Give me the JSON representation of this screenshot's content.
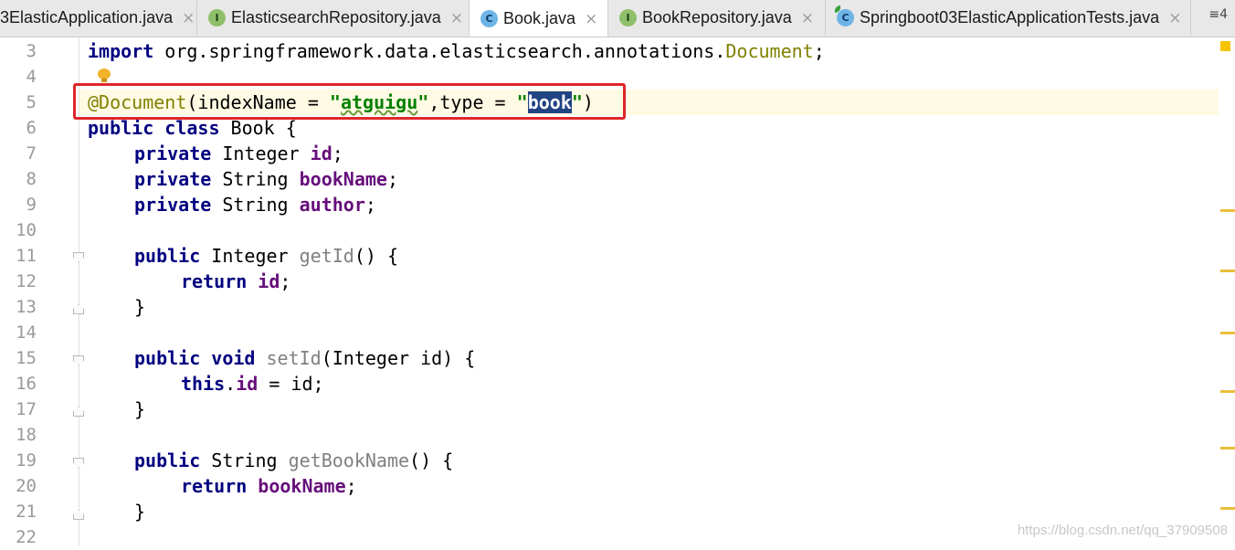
{
  "tabs": [
    {
      "label": "3ElasticApplication.java",
      "icon": "class-icon"
    },
    {
      "label": "ElasticsearchRepository.java",
      "icon": "interface-icon"
    },
    {
      "label": "Book.java",
      "icon": "class-icon",
      "active": true
    },
    {
      "label": "BookRepository.java",
      "icon": "interface-icon"
    },
    {
      "label": "Springboot03ElasticApplicationTests.java",
      "icon": "class-icon"
    }
  ],
  "tab_overflow": "≡4",
  "close_glyph": "×",
  "line_numbers": [
    "3",
    "4",
    "5",
    "6",
    "7",
    "8",
    "9",
    "10",
    "11",
    "12",
    "13",
    "14",
    "15",
    "16",
    "17",
    "18",
    "19",
    "20",
    "21",
    "22"
  ],
  "code": {
    "l3_kw": "import",
    "l3_pkg": " org.springframework.data.elasticsearch.annotations.",
    "l3_ann": "Document",
    "l3_end": ";",
    "l5_ann": "@Document",
    "l5_a": "(indexName = ",
    "l5_q1": "\"",
    "l5_s1": "atguigu",
    "l5_b": ",type = ",
    "l5_sel": "book",
    "l5_c": ")",
    "l6_kw": "public class",
    "l6_rest": " Book {",
    "l7_kw": "private",
    "l7_type": " Integer ",
    "l7_fld": "id",
    "l8_kw": "private",
    "l8_type": " String ",
    "l8_fld": "bookName",
    "l9_kw": "private",
    "l9_type": " String ",
    "l9_fld": "author",
    "semi": ";",
    "l11_kw": "public",
    "l11_type": " Integer ",
    "l11_m": "getId",
    "l11_end": "() {",
    "l12_kw": "return",
    "l12_fld": "id",
    "brace_close": "}",
    "l15_kw": "public void",
    "l15_m": "setId",
    "l15_end": "(Integer id) {",
    "l16_kw": "this",
    "l16_dot": ".",
    "l16_fld": "id",
    "l16_end": " = id;",
    "l19_kw": "public",
    "l19_type": " String ",
    "l19_m": "getBookName",
    "l19_end": "() {",
    "l20_kw": "return",
    "l20_fld": "bookName"
  },
  "watermark": "https://blog.csdn.net/qq_37909508",
  "colors": {
    "keyword": "#000080",
    "annotation": "#808000",
    "string": "#008000",
    "field": "#660e7a",
    "highlight_box": "#e0262b",
    "selection": "#214283"
  }
}
